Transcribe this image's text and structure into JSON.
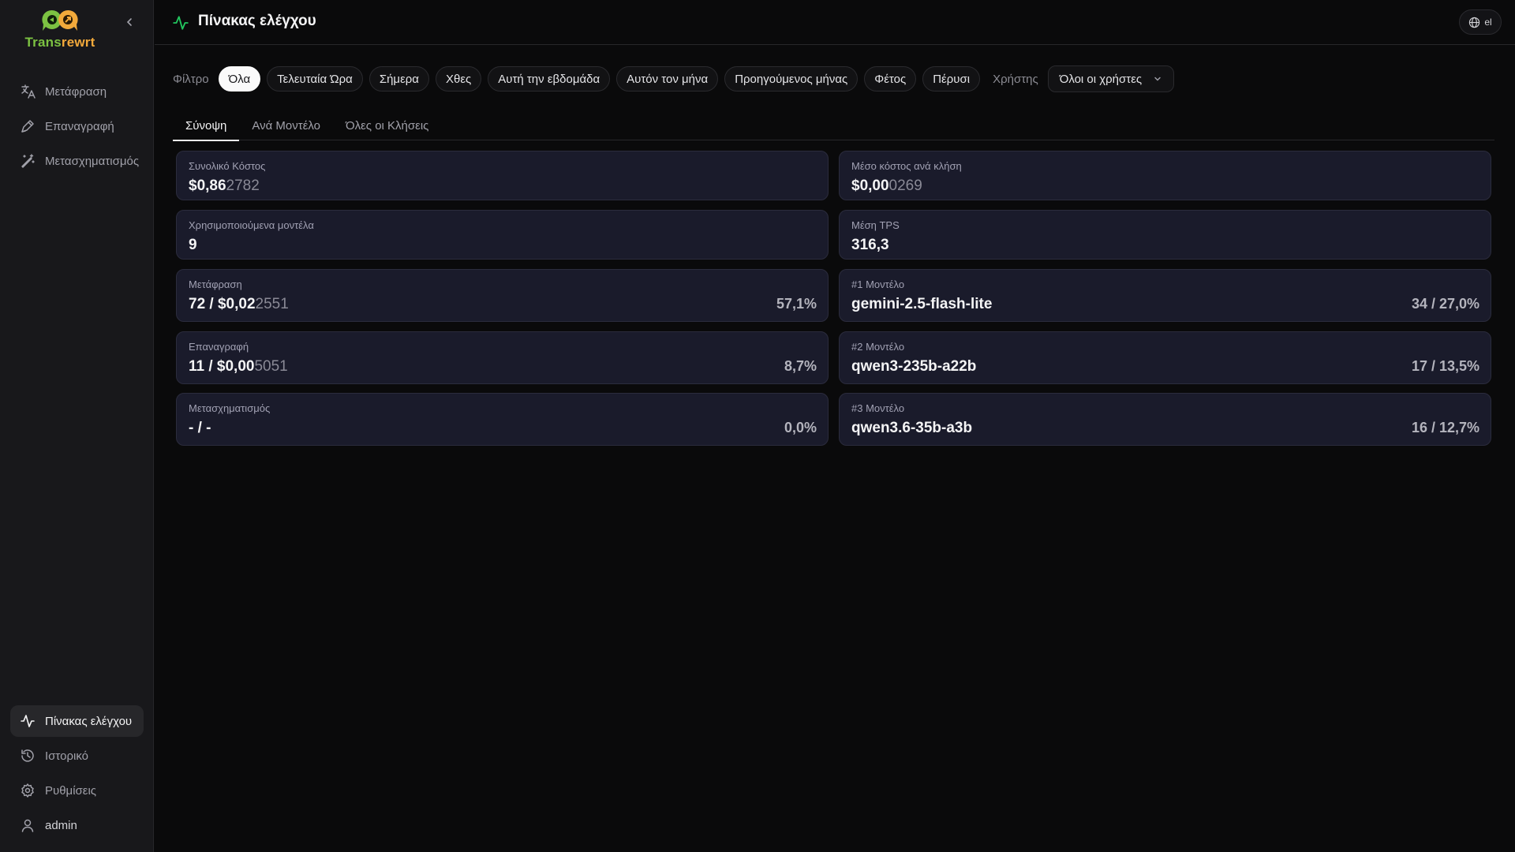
{
  "app": {
    "name_part1": "Trans",
    "name_part2": "rewrt"
  },
  "sidebar": {
    "top_items": [
      {
        "label": "Μετάφραση",
        "icon": "translate-icon"
      },
      {
        "label": "Επαναγραφή",
        "icon": "pen-icon"
      },
      {
        "label": "Μετασχηματισμός",
        "icon": "magic-wand-icon"
      }
    ],
    "bottom_items": [
      {
        "label": "Πίνακας ελέγχου",
        "icon": "activity-icon",
        "active": true
      },
      {
        "label": "Ιστορικό",
        "icon": "history-icon"
      },
      {
        "label": "Ρυθμίσεις",
        "icon": "gear-icon"
      },
      {
        "label": "admin",
        "icon": "user-icon"
      }
    ]
  },
  "header": {
    "title": "Πίνακας ελέγχου",
    "lang": "el"
  },
  "filter": {
    "label": "Φίλτρο",
    "chips": [
      "Όλα",
      "Τελευταία Ώρα",
      "Σήμερα",
      "Χθες",
      "Αυτή την εβδομάδα",
      "Αυτόν τον μήνα",
      "Προηγούμενος μήνας",
      "Φέτος",
      "Πέρυσι"
    ],
    "active": "Όλα",
    "user_label": "Χρήστης",
    "user_value": "Όλοι οι χρήστες"
  },
  "tabs": [
    "Σύνοψη",
    "Ανά Μοντέλο",
    "Όλες οι Κλήσεις"
  ],
  "active_tab": "Σύνοψη",
  "cards": {
    "total_cost": {
      "label": "Συνολικό Κόστος",
      "main": "$0,86",
      "dim": "2782"
    },
    "avg_cost": {
      "label": "Μέσο κόστος ανά κλήση",
      "main": "$0,00",
      "dim": "0269"
    },
    "models_used": {
      "label": "Χρησιμοποιούμενα μοντέλα",
      "main": "9"
    },
    "avg_tps": {
      "label": "Μέση TPS",
      "main": "316,3"
    },
    "translate": {
      "label": "Μετάφραση",
      "main": "72 / $0,02",
      "dim": "2551",
      "pct": "57,1%"
    },
    "rewrite": {
      "label": "Επαναγραφή",
      "main": "11 / $0,00",
      "dim": "5051",
      "pct": "8,7%"
    },
    "transform": {
      "label": "Μετασχηματισμός",
      "main": "- / -",
      "pct": "0,0%"
    },
    "model1": {
      "label": "#1 Μοντέλο",
      "main": "gemini-2.5-flash-lite",
      "pct": "34 / 27,0%"
    },
    "model2": {
      "label": "#2 Μοντέλο",
      "main": "qwen3-235b-a22b",
      "pct": "17 / 13,5%"
    },
    "model3": {
      "label": "#3 Μοντέλο",
      "main": "qwen3.6-35b-a3b",
      "pct": "16 / 12,7%"
    }
  },
  "colors": {
    "accent_green": "#22c55e",
    "logo_green": "#7cc242",
    "logo_orange": "#f2a93b",
    "card_bg": "#1a1b2b"
  }
}
